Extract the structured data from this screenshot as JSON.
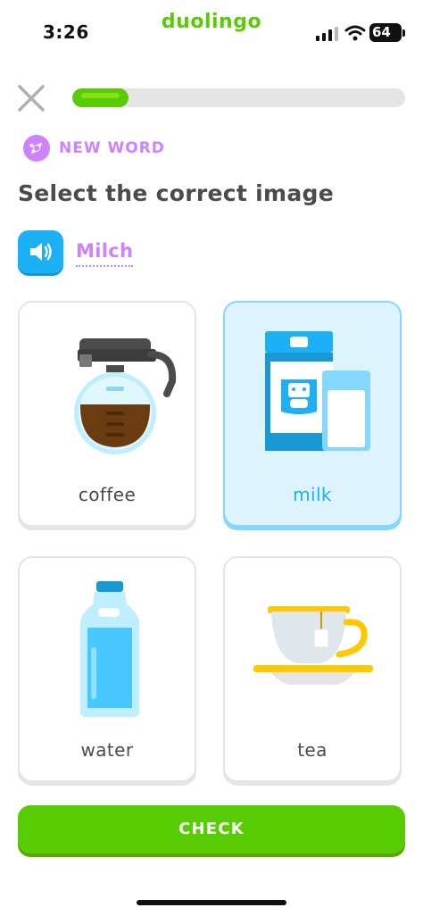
{
  "status_bar": {
    "time": "3:26",
    "brand": "duolingo",
    "battery": "64"
  },
  "lesson": {
    "progress": 0.17,
    "tag": {
      "label": "NEW WORD",
      "icon": "sparkle-badge-icon"
    },
    "prompt": "Select the correct image",
    "word": "Milch",
    "audio_icon": "speaker-icon"
  },
  "options": [
    {
      "label": "coffee",
      "icon": "coffee-pot-icon",
      "selected": false
    },
    {
      "label": "milk",
      "icon": "milk-carton-icon",
      "selected": true
    },
    {
      "label": "water",
      "icon": "water-bottle-icon",
      "selected": false
    },
    {
      "label": "tea",
      "icon": "teacup-icon",
      "selected": false
    }
  ],
  "check_button": {
    "label": "CHECK"
  },
  "colors": {
    "brand_green": "#58cc02",
    "accent_purple": "#ce82ff",
    "accent_blue": "#1cb0f6",
    "selected_bg": "#ddf4ff",
    "text_gray": "#4b4b4b"
  }
}
